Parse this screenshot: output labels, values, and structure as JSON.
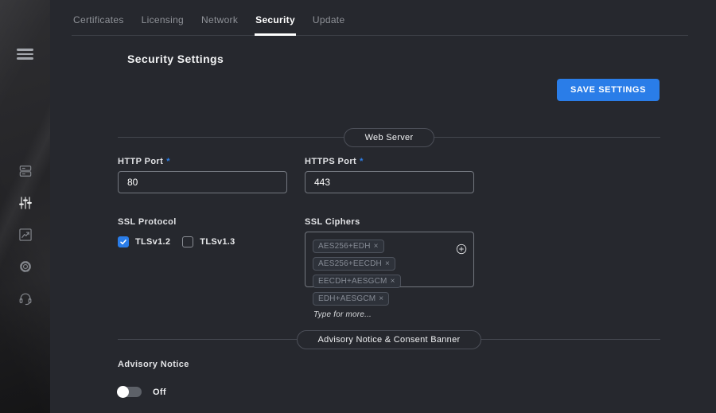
{
  "page": {
    "title": "Security Settings"
  },
  "toolbar": {
    "save_label": "SAVE SETTINGS"
  },
  "tabs": [
    {
      "label": "Certificates",
      "active": false
    },
    {
      "label": "Licensing",
      "active": false
    },
    {
      "label": "Network",
      "active": false
    },
    {
      "label": "Security",
      "active": true
    },
    {
      "label": "Update",
      "active": false
    }
  ],
  "sidebar": {
    "icons": [
      "menu-icon",
      "server-stack-icon",
      "sliders-icon",
      "analytics-chart-icon",
      "settings-gear-icon",
      "support-headset-icon"
    ],
    "active_icon": "sliders-icon"
  },
  "sections": {
    "web_server": {
      "title": "Web Server"
    },
    "advisory": {
      "title": "Advisory Notice & Consent Banner"
    }
  },
  "fields": {
    "http_port": {
      "label": "HTTP Port",
      "value": "80",
      "required": true
    },
    "https_port": {
      "label": "HTTPS Port",
      "value": "443",
      "required": true
    },
    "ssl_protocol": {
      "label": "SSL Protocol",
      "options": [
        {
          "label": "TLSv1.2",
          "checked": true
        },
        {
          "label": "TLSv1.3",
          "checked": false
        }
      ]
    },
    "ssl_ciphers": {
      "label": "SSL Ciphers",
      "chips": [
        "AES256+EDH",
        "AES256+EECDH",
        "EECDH+AESGCM",
        "EDH+AESGCM"
      ],
      "placeholder": "Type for more..."
    },
    "advisory_notice": {
      "label": "Advisory Notice",
      "state": "Off",
      "on": false
    }
  },
  "misc": {
    "required_marker": "*",
    "remove_glyph": "×"
  },
  "colors": {
    "accent_blue": "#2a7de9",
    "background": "#26282e",
    "sidebar_background": "#252528",
    "input_border": "#73777f",
    "divider": "#44474f",
    "tab_inactive_text": "#8f9298",
    "chip_text": "#868b95"
  }
}
